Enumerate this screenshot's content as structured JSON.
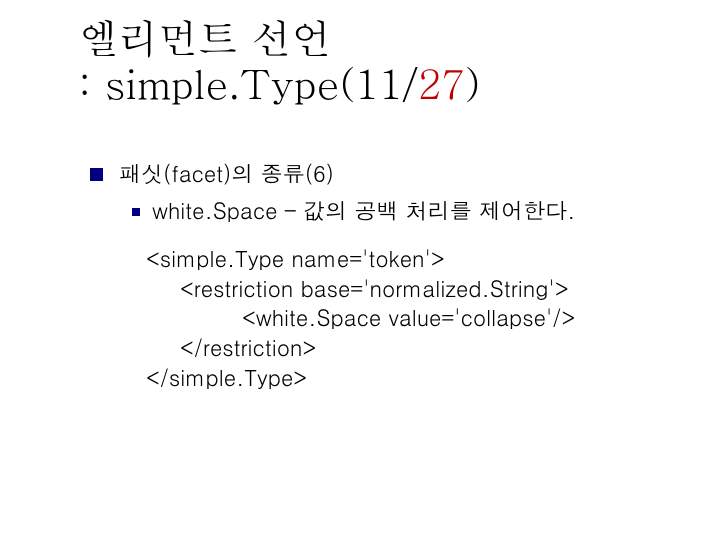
{
  "title": {
    "line1": "엘리먼트 선언",
    "line2_prefix": ": simple.Type(11/",
    "line2_accent": "27",
    "line2_suffix": ")"
  },
  "bullet1": "패싯(facet)의 종류(6)",
  "bullet2": "white.Space – 값의 공백 처리를 제어한다.",
  "code": {
    "l1": "<simple.Type name='token'>",
    "l2": "<restriction base='normalized.String'>",
    "l3": "<white.Space value='collapse'/>",
    "l4": "</restriction>",
    "l5": "</simple.Type>"
  }
}
